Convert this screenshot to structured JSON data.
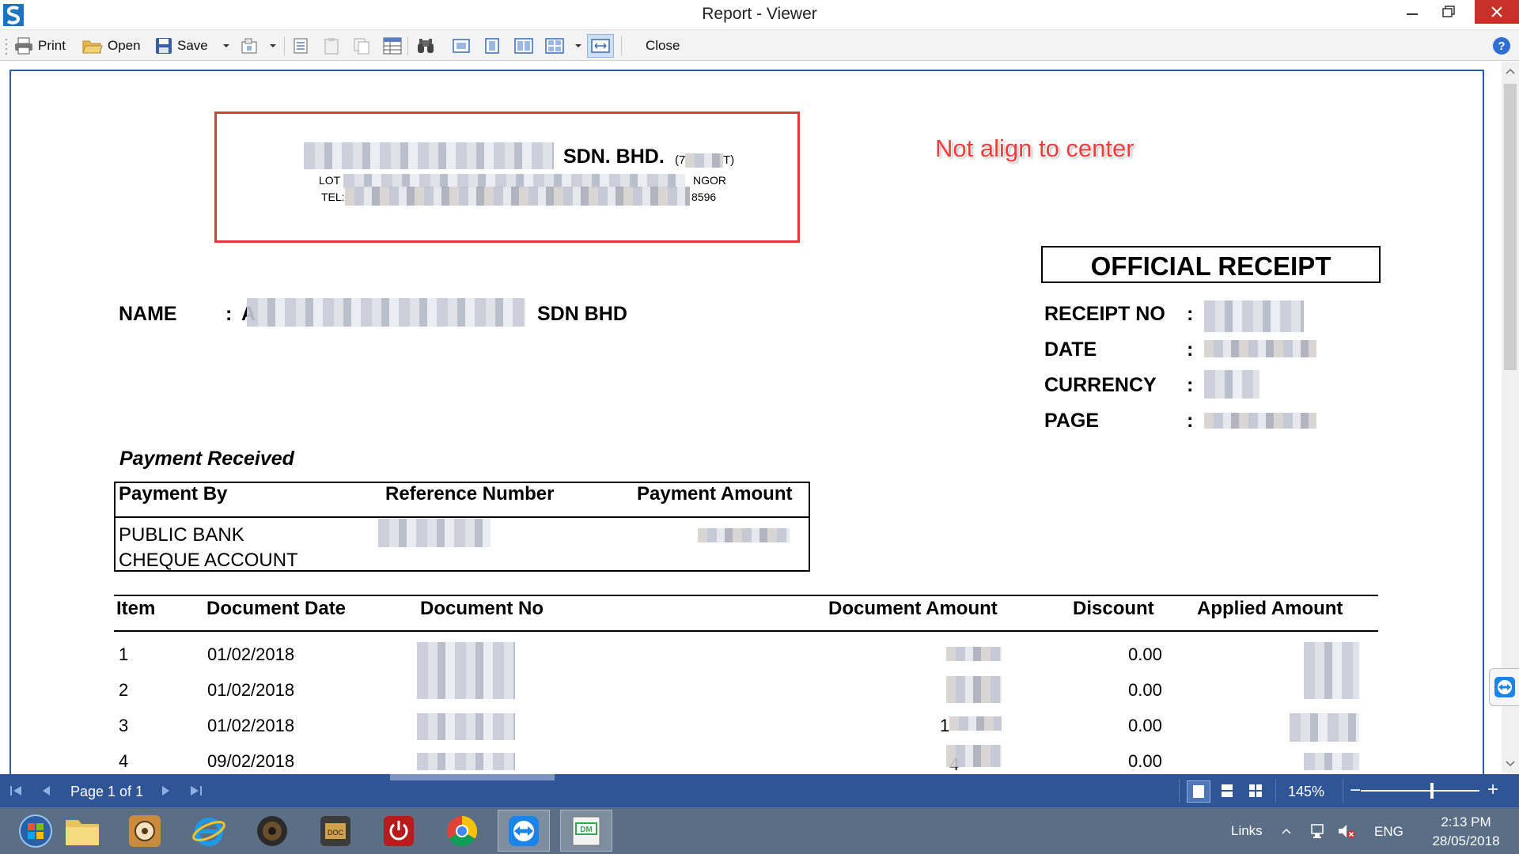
{
  "window": {
    "title": "Report - Viewer"
  },
  "toolbar": {
    "print_label": "Print",
    "open_label": "Open",
    "save_label": "Save",
    "close_label": "Close"
  },
  "annotation": {
    "text": "Not align to center"
  },
  "report": {
    "company_name_suffix": "SDN. BHD.",
    "company_reg_suffix": "(7",
    "company_reg_end": "T)",
    "address_prefix": "LOT",
    "address_suffix": "NGOR",
    "tel_prefix": "TEL:",
    "tel_suffix": "8596",
    "receipt_title": "OFFICIAL RECEIPT",
    "name_label": "NAME",
    "colon": ":",
    "name_prefix": "A",
    "name_suffix": "SDN BHD",
    "receipt_fields": [
      {
        "label": "RECEIPT NO",
        "colon": ":"
      },
      {
        "label": "DATE",
        "colon": ":"
      },
      {
        "label": "CURRENCY",
        "colon": ":"
      },
      {
        "label": "PAGE",
        "colon": ":"
      }
    ],
    "payment_received_title": "Payment Received",
    "payment_table": {
      "headers": [
        "Payment By",
        "Reference Number",
        "Payment Amount"
      ],
      "payment_by_line1": "PUBLIC BANK",
      "payment_by_line2": "CHEQUE ACCOUNT"
    },
    "items_table": {
      "headers": [
        "Item",
        "Document Date",
        "Document No",
        "Document Amount",
        "Discount",
        "Applied Amount"
      ],
      "rows": [
        {
          "item": "1",
          "date": "01/02/2018",
          "discount": "0.00",
          "amount_prefix": ""
        },
        {
          "item": "2",
          "date": "01/02/2018",
          "discount": "0.00",
          "amount_prefix": ""
        },
        {
          "item": "3",
          "date": "01/02/2018",
          "discount": "0.00",
          "amount_prefix": "1"
        },
        {
          "item": "4",
          "date": "09/02/2018",
          "discount": "0.00",
          "amount_prefix": "4"
        }
      ]
    }
  },
  "statusbar": {
    "page_text": "Page 1 of 1",
    "zoom": "145%",
    "zoom_minus": "−",
    "zoom_plus": "+"
  },
  "taskbar": {
    "links_label": "Links",
    "lang": "ENG",
    "time": "2:13 PM",
    "date": "28/05/2018"
  },
  "colors": {
    "accent": "#2f5597",
    "annotation_red": "#e03b3b",
    "close_button_red": "#c8312a"
  }
}
